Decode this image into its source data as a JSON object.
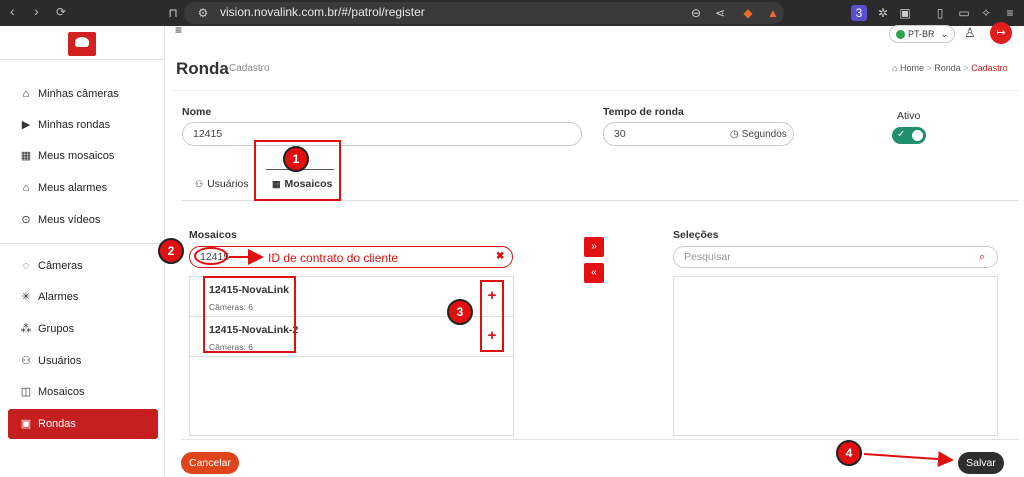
{
  "browser": {
    "url": "vision.novalink.com.br/#/patrol/register",
    "extension_badge": "3"
  },
  "header": {
    "language": "PT-BR"
  },
  "sidebar": {
    "items": [
      {
        "label": "Minhas câmeras",
        "icon": "home-icon"
      },
      {
        "label": "Minhas rondas",
        "icon": "play-square-icon"
      },
      {
        "label": "Meus mosaicos",
        "icon": "grid-icon"
      },
      {
        "label": "Meus alarmes",
        "icon": "alarm-icon"
      },
      {
        "label": "Meus vídeos",
        "icon": "play-circle-icon"
      },
      {
        "label": "Câmeras",
        "icon": "camera-icon"
      },
      {
        "label": "Alarmes",
        "icon": "siren-icon"
      },
      {
        "label": "Grupos",
        "icon": "group-icon"
      },
      {
        "label": "Usuários",
        "icon": "users-icon"
      },
      {
        "label": "Mosaicos",
        "icon": "mosaic-icon"
      },
      {
        "label": "Rondas",
        "icon": "patrol-icon",
        "active": true
      }
    ]
  },
  "page": {
    "title": "Ronda",
    "subtitle": "Cadastro",
    "breadcrumb": {
      "home": "Home",
      "sep": ">",
      "section": "Ronda",
      "current": "Cadastro"
    }
  },
  "form": {
    "name_label": "Nome",
    "name_value": "12415",
    "time_label": "Tempo de ronda",
    "time_value": "30",
    "time_unit": "Segundos",
    "active_label": "Ativo",
    "active": true
  },
  "tabs": [
    {
      "label": "Usuários",
      "active": false
    },
    {
      "label": "Mosaicos",
      "active": true
    }
  ],
  "mosaicos": {
    "label": "Mosaicos",
    "search_value": "12415",
    "items": [
      {
        "name": "12415-NovaLink",
        "meta": "Câmeras: 6"
      },
      {
        "name": "12415-NovaLink-2",
        "meta": "Câmeras: 6"
      }
    ]
  },
  "selecoes": {
    "label": "Seleções",
    "search_placeholder": "Pesquisar"
  },
  "transfer": {
    "right": "»",
    "left": "«"
  },
  "buttons": {
    "cancel": "Cancelar",
    "save": "Salvar"
  },
  "annotations": {
    "n1": "1",
    "n2": "2",
    "n3": "3",
    "n4": "4",
    "note": "ID de contrato do cliente",
    "color": "#e01010"
  }
}
